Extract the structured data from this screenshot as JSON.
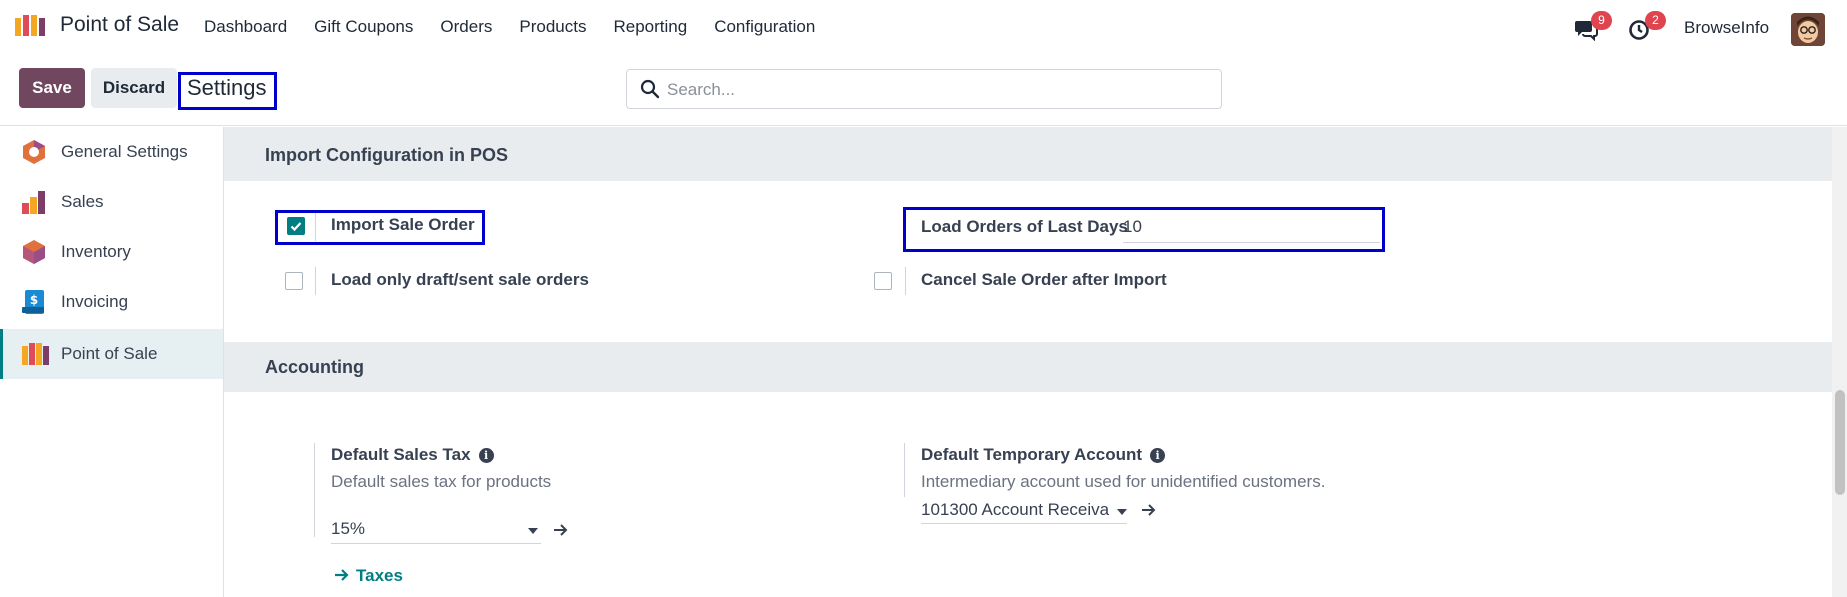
{
  "app": {
    "name": "Point of Sale",
    "menu": [
      "Dashboard",
      "Gift Coupons",
      "Orders",
      "Products",
      "Reporting",
      "Configuration"
    ],
    "messages_count": "9",
    "activities_count": "2",
    "company": "BrowseInfo"
  },
  "control": {
    "save_label": "Save",
    "discard_label": "Discard",
    "breadcrumb": "Settings",
    "search_placeholder": "Search..."
  },
  "sidebar": {
    "items": [
      {
        "label": "General Settings",
        "icon": "general-settings-icon"
      },
      {
        "label": "Sales",
        "icon": "sales-icon"
      },
      {
        "label": "Inventory",
        "icon": "inventory-icon"
      },
      {
        "label": "Invoicing",
        "icon": "invoicing-icon"
      },
      {
        "label": "Point of Sale",
        "icon": "point-of-sale-icon",
        "active": true
      }
    ]
  },
  "import_section": {
    "title": "Import Configuration in POS",
    "import_sale_order": {
      "label": "Import Sale Order",
      "checked": true
    },
    "load_orders_days": {
      "label": "Load Orders of Last Days",
      "value": "10"
    },
    "draft_sent_only": {
      "label": "Load only draft/sent sale orders",
      "checked": false
    },
    "cancel_after_import": {
      "label": "Cancel Sale Order after Import",
      "checked": false
    }
  },
  "accounting_section": {
    "title": "Accounting",
    "default_sales_tax": {
      "label": "Default Sales Tax",
      "description": "Default sales tax for products",
      "value": "15%",
      "link": "Taxes"
    },
    "default_temp_account": {
      "label": "Default Temporary Account",
      "description": "Intermediary account used for unidentified customers.",
      "value": "101300 Account Receiva"
    }
  },
  "colors": {
    "primary": "#71475f",
    "accent": "#017e84",
    "highlight_box": "#0000cc",
    "badge": "#e0454f"
  }
}
